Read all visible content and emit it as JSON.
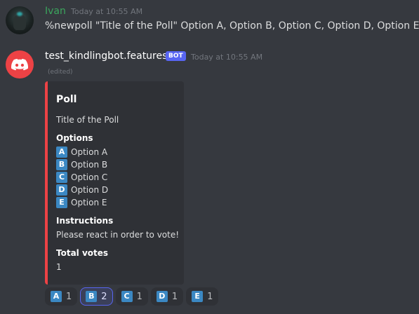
{
  "messages": [
    {
      "author": "Ivan",
      "timestamp": "Today at 10:55 AM",
      "content": "%newpoll \"Title of the Poll\" Option A, Option B, Option C, Option D, Option E",
      "name_color": "#3ba55d"
    },
    {
      "author": "test_kindlingbot.features",
      "bot_tag": "BOT",
      "timestamp": "Today at 10:55 AM",
      "edited_label": "(edited)",
      "embed": {
        "accent_color": "#ed4245",
        "title": "Poll",
        "description": "Title of the Poll",
        "options_heading": "Options",
        "options": [
          {
            "letter": "A",
            "label": "Option A"
          },
          {
            "letter": "B",
            "label": "Option B"
          },
          {
            "letter": "C",
            "label": "Option C"
          },
          {
            "letter": "D",
            "label": "Option D"
          },
          {
            "letter": "E",
            "label": "Option E"
          }
        ],
        "instructions_heading": "Instructions",
        "instructions": "Please react in order to vote!",
        "total_votes_heading": "Total votes",
        "total_votes": "1"
      },
      "reactions": [
        {
          "letter": "A",
          "count": "1",
          "active": false
        },
        {
          "letter": "B",
          "count": "2",
          "active": true
        },
        {
          "letter": "C",
          "count": "1",
          "active": false
        },
        {
          "letter": "D",
          "count": "1",
          "active": false
        },
        {
          "letter": "E",
          "count": "1",
          "active": false
        }
      ]
    }
  ],
  "colors": {
    "background": "#36393f",
    "embed_bg": "#2f3136",
    "letter_icon": "#3b88c3",
    "bot_tag": "#5865f2"
  }
}
